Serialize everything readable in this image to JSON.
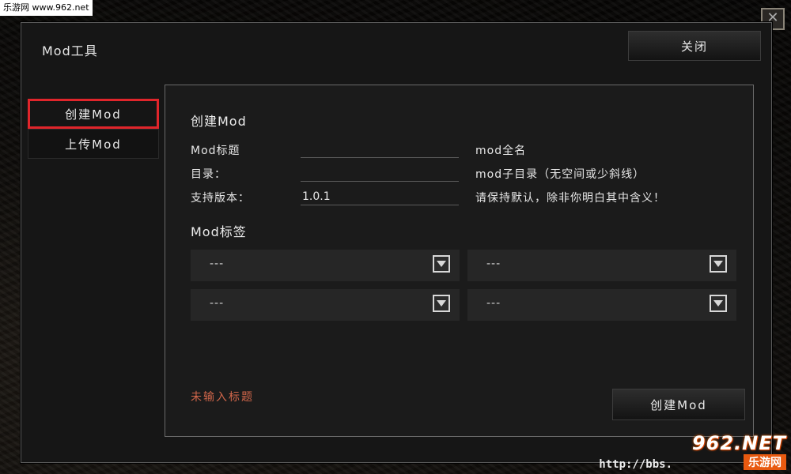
{
  "watermark": {
    "top_left": "乐游网 www.962.net",
    "bottom_url": "http://bbs.",
    "logo_num": "962.NET",
    "logo_site": "乐游网"
  },
  "window_close_glyph": "✕",
  "dialog": {
    "title": "Mod工具",
    "close_label": "关闭",
    "tabs": [
      {
        "label": "创建Mod",
        "active": true
      },
      {
        "label": "上传Mod",
        "active": false
      }
    ]
  },
  "form": {
    "section_title": "创建Mod",
    "fields": [
      {
        "label": "Mod标题",
        "value": "",
        "hint": "mod全名"
      },
      {
        "label": "目录：",
        "value": "",
        "hint": "mod子目录（无空间或少斜线）"
      },
      {
        "label": "支持版本：",
        "value": "1.0.1",
        "hint": "请保持默认，除非你明白其中含义！"
      }
    ],
    "tags_title": "Mod标签",
    "tags": [
      "---",
      "---",
      "---",
      "---"
    ],
    "error": "未输入标题",
    "create_label": "创建Mod"
  },
  "colors": {
    "active_tab_border": "#e0252b",
    "error_text": "#d0664a"
  }
}
